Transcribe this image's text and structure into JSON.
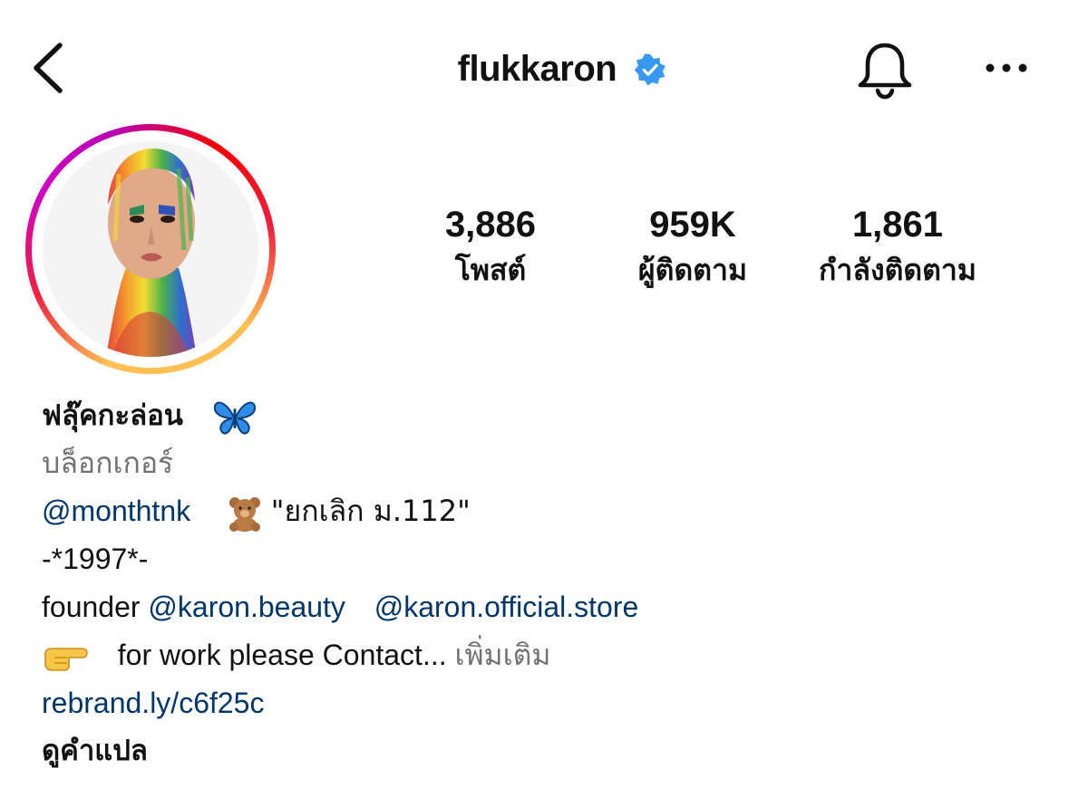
{
  "header": {
    "back_icon": "chevron-left-icon",
    "username": "flukkaron",
    "verified_icon": "verified-badge-icon",
    "verified_color": "#3897f0",
    "bell_icon": "bell-icon",
    "more_icon": "more-horizontal-icon"
  },
  "profile": {
    "avatar_icon": "profile-avatar",
    "story_ring_colors": [
      "#fec053",
      "#f2203e",
      "#d300c5"
    ]
  },
  "stats": [
    {
      "value": "3,886",
      "label": "โพสต์"
    },
    {
      "value": "959K",
      "label": "ผู้ติดตาม"
    },
    {
      "value": "1,861",
      "label": "กำลังติดตาม"
    }
  ],
  "bio": {
    "full_name": "ฟลุ๊คกะล่อน",
    "name_emoji": "butterfly-icon",
    "category": "บล็อกเกอร์",
    "line1_mention": "@monthtnk",
    "line1_emoji": "teddy-bear-icon",
    "line1_text": "\"ยกเลิก ม.112\"",
    "line2_text": "-*1997*-",
    "line3_prefix": "founder",
    "line3_mention1": "@karon.beauty",
    "line3_mention2": "@karon.official.store",
    "line4_emoji": "pointing-hand-icon",
    "line4_text": "for work please Contact...",
    "line4_more": "เพิ่มเติม",
    "website": "rebrand.ly/c6f25c",
    "translate": "ดูคำแปล"
  },
  "colors": {
    "link": "#00376b",
    "secondary_text": "#737373",
    "primary_text": "#111111"
  }
}
